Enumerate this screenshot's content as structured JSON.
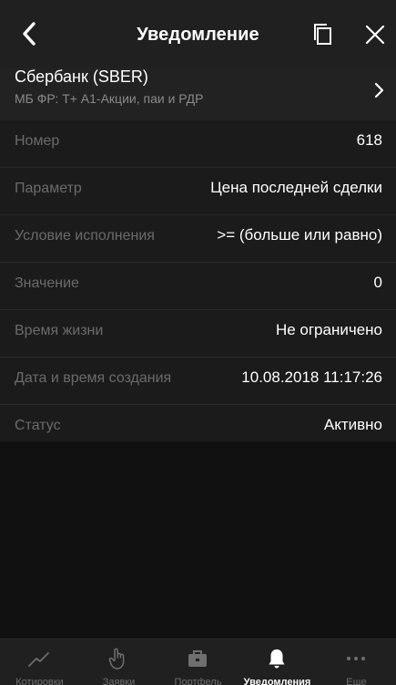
{
  "header": {
    "title": "Уведомление"
  },
  "instrument": {
    "name": "Сбербанк (SBER)",
    "market": "МБ ФР: Т+ А1-Акции, паи и РДР"
  },
  "details": [
    {
      "label": "Номер",
      "value": "618"
    },
    {
      "label": "Параметр",
      "value": "Цена последней сделки"
    },
    {
      "label": "Условие исполнения",
      "value": ">= (больше или равно)"
    },
    {
      "label": "Значение",
      "value": "0"
    },
    {
      "label": "Время жизни",
      "value": "Не ограничено"
    },
    {
      "label": "Дата и время создания",
      "value": "10.08.2018 11:17:26"
    },
    {
      "label": "Статус",
      "value": "Активно"
    }
  ],
  "tabbar": {
    "active": "alerts",
    "tabs": [
      {
        "id": "quotes",
        "label": "Котировки",
        "icon": "chart-line-icon"
      },
      {
        "id": "orders",
        "label": "Заявки",
        "icon": "hand-icon"
      },
      {
        "id": "portfolio",
        "label": "Портфель",
        "icon": "briefcase-icon"
      },
      {
        "id": "alerts",
        "label": "Уведомления",
        "icon": "bell-icon"
      },
      {
        "id": "more",
        "label": "Еще",
        "icon": "more-dots-icon"
      }
    ]
  },
  "colors": {
    "background": "#1b1b1b",
    "header": "#202020",
    "label": "#6b6b6b",
    "value": "#ffffff",
    "inactive_tab": "#6f6f6f"
  }
}
